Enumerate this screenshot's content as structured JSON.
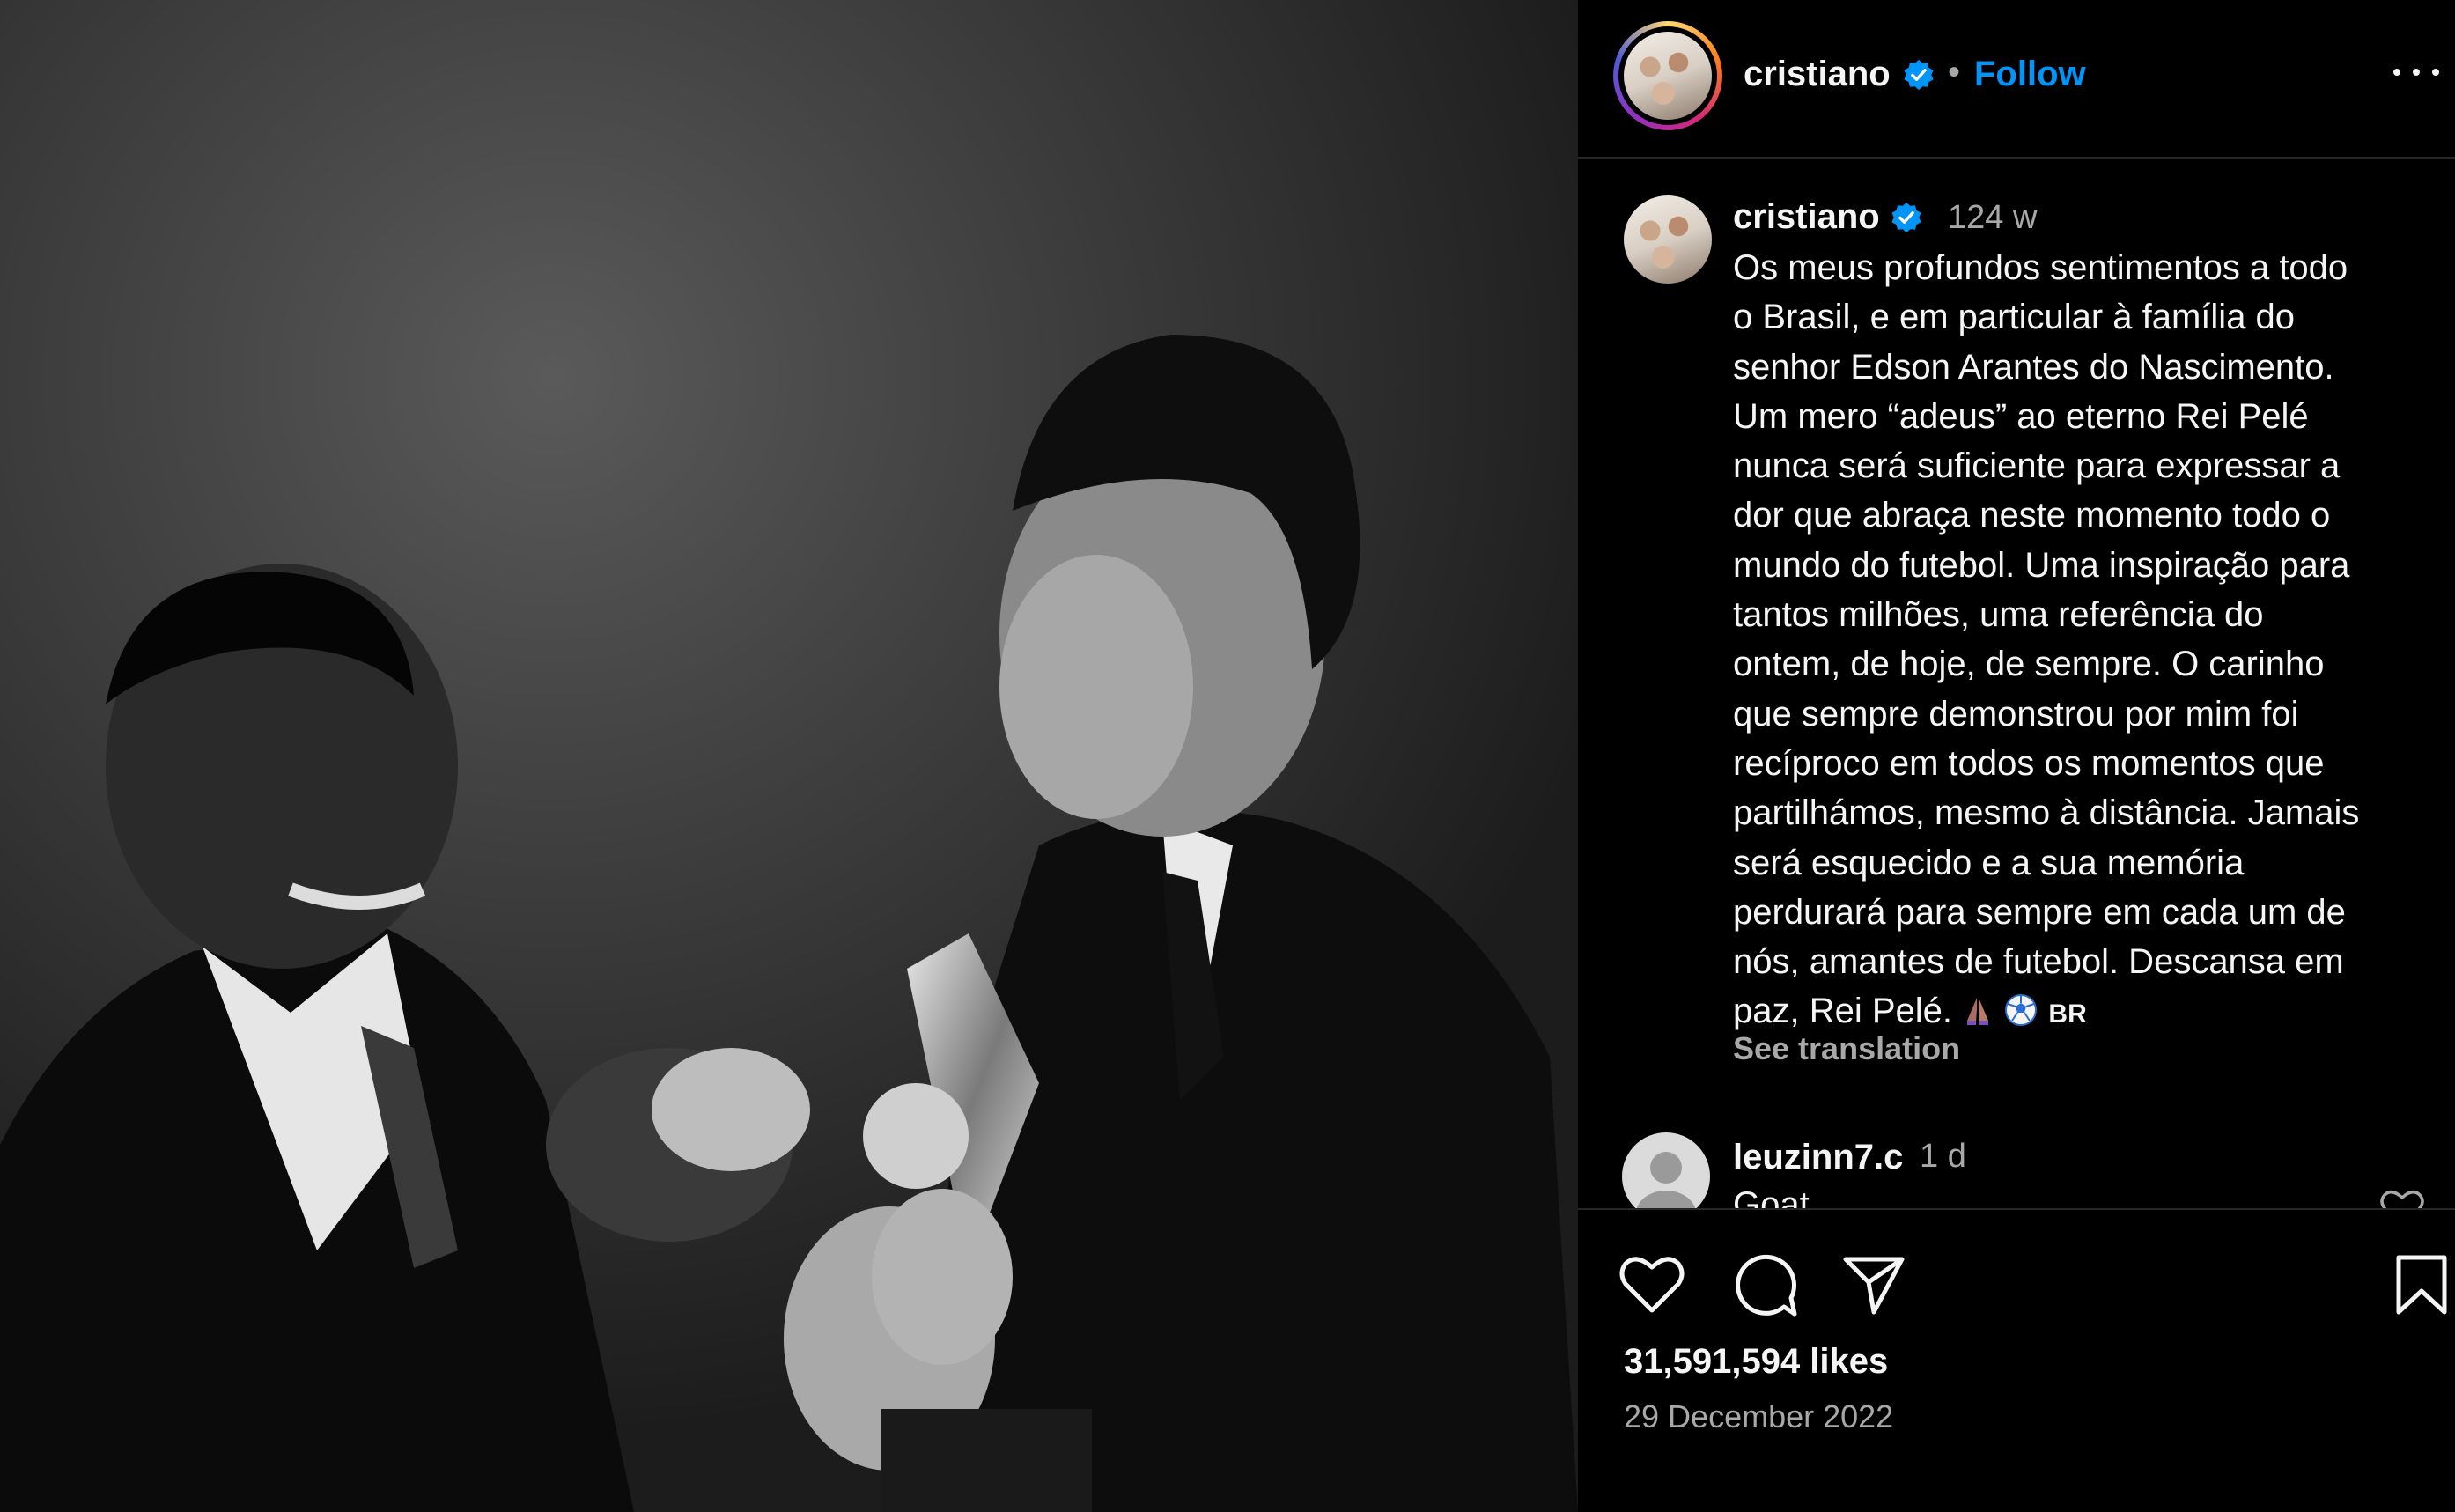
{
  "post": {
    "username": "cristiano",
    "verified": true,
    "follow_label": "Follow",
    "separator": "•",
    "more_icon": "more-horizontal-icon"
  },
  "caption": {
    "username": "cristiano",
    "time": "124 w",
    "lines": [
      "Os meus profundos sentimentos a todo",
      "o Brasil, e em particular à família do",
      "senhor Edson Arantes do Nascimento.",
      "Um mero “adeus” ao eterno Rei Pelé",
      "nunca será suficiente para expressar a",
      "dor que abraça neste momento todo o",
      "mundo do futebol. Uma inspiração para",
      "tantos milhões, uma referência do",
      "ontem, de hoje, de sempre. O carinho",
      "que sempre demonstrou por mim foi",
      "recíproco em todos os momentos que",
      "partilhámos, mesmo à distância. Jamais",
      "será esquecido e a sua memória",
      "perdurará para sempre em cada um de",
      "nós, amantes de futebol. Descansa em"
    ],
    "last_line": "paz, Rei Pelé.",
    "emojis": [
      "pray-emoji",
      "soccer-ball-emoji"
    ],
    "flag_text": "BR",
    "see_translation": "See translation"
  },
  "comment": {
    "username": "leuzinn7.c",
    "time": "1 d",
    "text": "Goat"
  },
  "actions": {
    "likes": "31,591,594 likes",
    "date": "29 December 2022"
  },
  "colors": {
    "link_blue": "#0095f6",
    "verified_blue": "#0095f6",
    "muted": "#a8a8a8",
    "divider": "#262626"
  }
}
